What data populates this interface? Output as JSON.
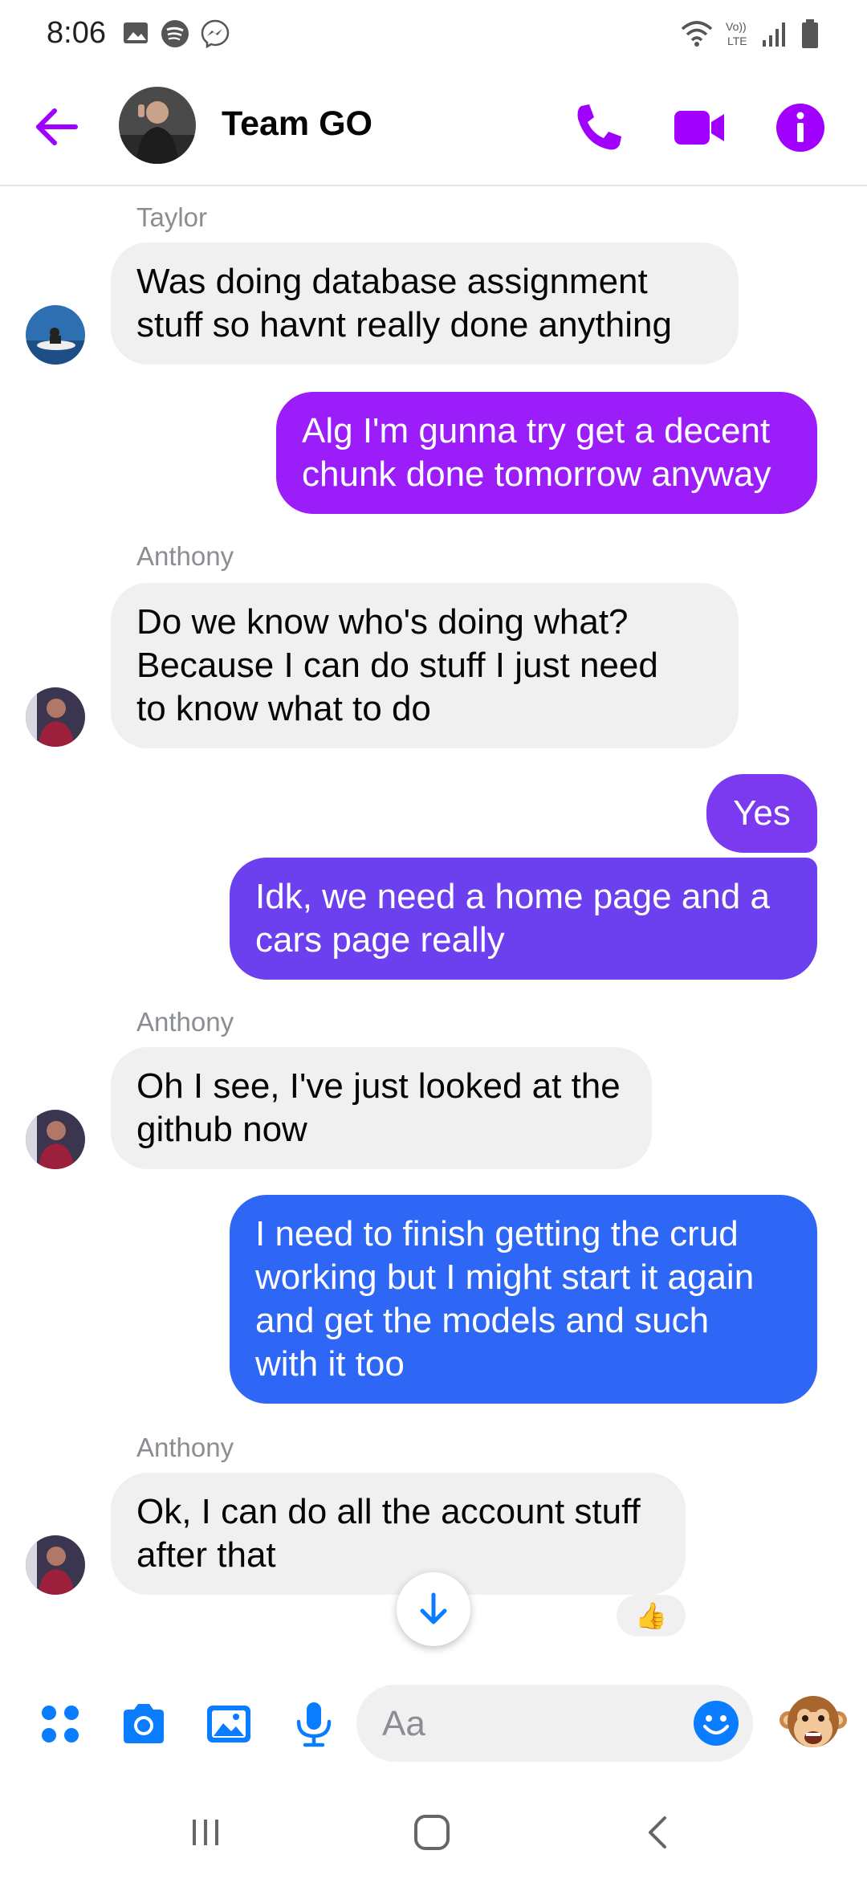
{
  "status_bar": {
    "time": "8:06",
    "left_icons": [
      "gallery-icon",
      "spotify-icon",
      "messenger-icon"
    ],
    "right_icons": [
      "wifi-icon",
      "volte-icon",
      "signal-icon",
      "battery-icon"
    ],
    "volte_label": "Vo))\nLTE"
  },
  "header": {
    "title": "Team GO",
    "accent_color": "#a100ff"
  },
  "messages": [
    {
      "type": "incoming",
      "sender": "Taylor",
      "line1": "Was doing database assignment",
      "line2": "stuff so havnt really done anything"
    },
    {
      "type": "outgoing",
      "line1": "Alg I'm gunna try get a decent",
      "line2": "chunk done tomorrow anyway",
      "color": "#9a1dfa"
    },
    {
      "type": "incoming",
      "sender": "Anthony",
      "line1": "Do we know who's doing what?",
      "line2": "Because I can do stuff I just need",
      "line3": "to know what to do"
    },
    {
      "type": "outgoing",
      "text": "Yes",
      "color": "#7c3af0"
    },
    {
      "type": "outgoing",
      "line1": "Idk, we need a home page and a",
      "line2": "cars page really",
      "color": "#6c40ee"
    },
    {
      "type": "incoming",
      "sender": "Anthony",
      "line1": "Oh I see, I've just looked at the",
      "line2": "github now"
    },
    {
      "type": "outgoing",
      "line1": "I need to finish getting the crud",
      "line2": "working but I might start it again",
      "line3": "and get the models and such",
      "line4": "with it too",
      "color": "#2e66f5"
    },
    {
      "type": "incoming",
      "sender": "Anthony",
      "line1": "Ok, I can do all the account stuff",
      "line2": "after that",
      "reaction": "👍"
    }
  ],
  "composer": {
    "placeholder": "Aa",
    "icons": [
      "apps-icon",
      "camera-icon",
      "gallery-icon",
      "microphone-icon",
      "emoji-icon",
      "monkey-sticker-icon"
    ],
    "accent_color": "#0a7cff"
  },
  "nav_bar": {
    "icons": [
      "recent-apps-icon",
      "home-icon",
      "back-icon"
    ]
  }
}
